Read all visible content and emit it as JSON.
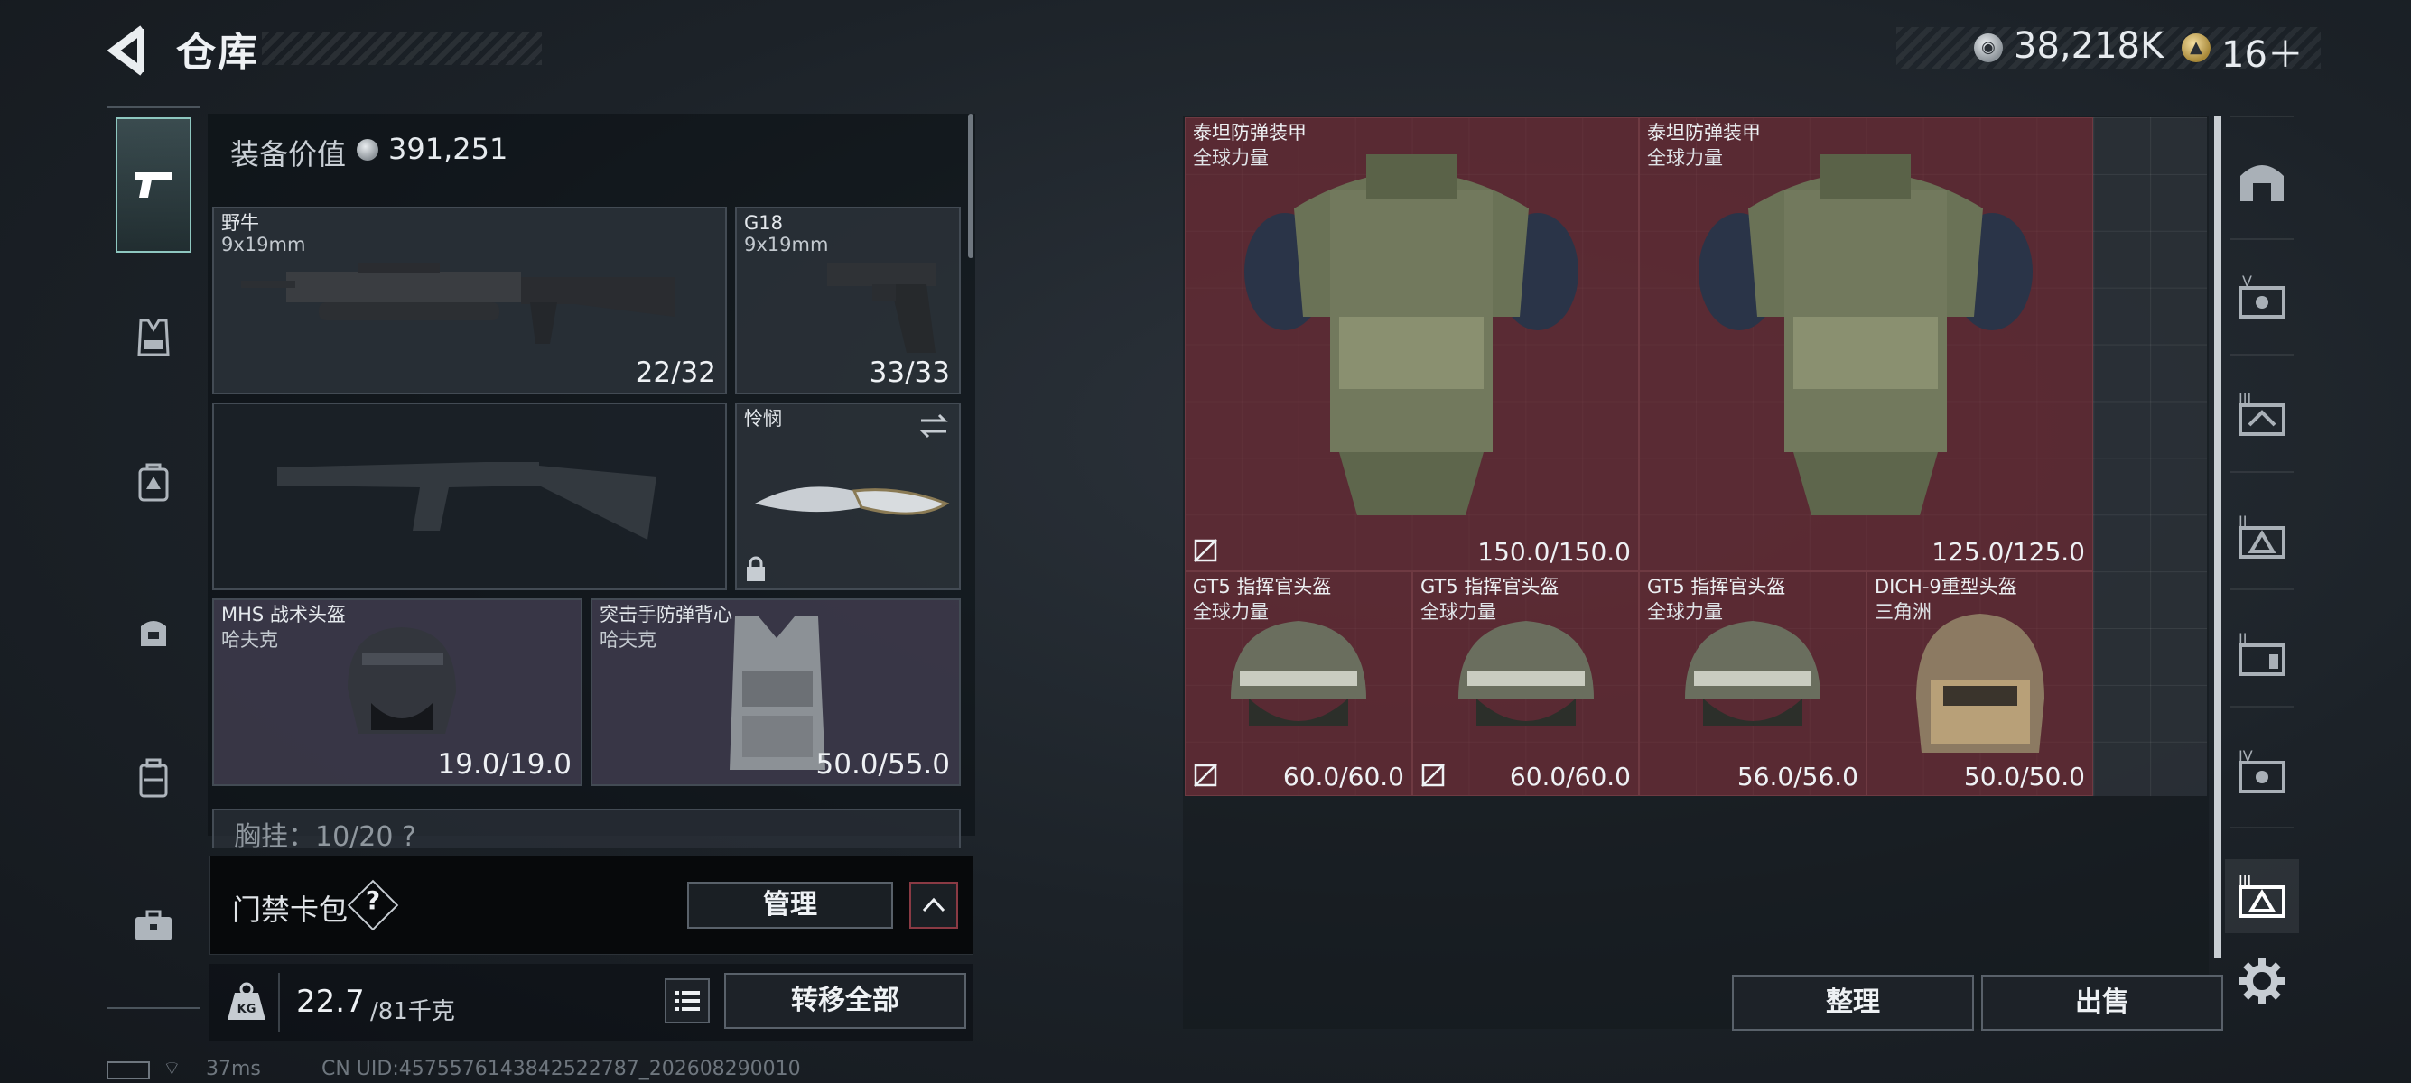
{
  "header": {
    "title": "仓库",
    "currencies": [
      {
        "icon": "silver-coin-icon",
        "value": "38,218K"
      },
      {
        "icon": "gold-coin-icon",
        "value": "16＋"
      }
    ]
  },
  "left_tabs": [
    {
      "icon": "pistol-icon",
      "active": true
    },
    {
      "icon": "vest-icon",
      "active": false
    },
    {
      "icon": "backpack-icon",
      "active": false
    },
    {
      "icon": "bag-icon",
      "active": false
    },
    {
      "icon": "case-icon",
      "active": false
    },
    {
      "icon": "toolbox-icon",
      "active": false
    }
  ],
  "loadout": {
    "equipment_value_label": "装备价值",
    "equipment_value": "391,251",
    "slots": {
      "primary": {
        "name": "野牛",
        "caliber": "9x19mm",
        "ammo": "22/32"
      },
      "pistol": {
        "name": "G18",
        "caliber": "9x19mm",
        "ammo": "33/33"
      },
      "melee": {
        "name": "怜悯",
        "locked": true
      },
      "helmet": {
        "name": "MHS 战术头盔",
        "brand": "哈夫克",
        "durability": "19.0/19.0"
      },
      "armor": {
        "name": "突击手防弹背心",
        "brand": "哈夫克",
        "durability": "50.0/55.0"
      }
    },
    "chest_rig_partial": "胸挂：10/20  ?",
    "keycard": {
      "label": "门禁卡包",
      "help": "?",
      "manage_label": "管理"
    },
    "weight": {
      "current": "22.7",
      "max": "/81千克"
    },
    "transfer_all_label": "转移全部"
  },
  "status": {
    "ping": "37ms",
    "uid": "CN UID:4575576143842522787_202608290010"
  },
  "stash": {
    "items": [
      {
        "id": "a1",
        "name": "泰坦防弹装甲",
        "brand": "全球力量",
        "durability": "150.0/150.0",
        "no_insure": true
      },
      {
        "id": "a2",
        "name": "泰坦防弹装甲",
        "brand": "全球力量",
        "durability": "125.0/125.0",
        "no_insure": false
      },
      {
        "id": "h1",
        "name": "GT5 指挥官头盔",
        "brand": "全球力量",
        "durability": "60.0/60.0",
        "no_insure": true
      },
      {
        "id": "h2",
        "name": "GT5 指挥官头盔",
        "brand": "全球力量",
        "durability": "60.0/60.0",
        "no_insure": true
      },
      {
        "id": "h3",
        "name": "GT5 指挥官头盔",
        "brand": "全球力量",
        "durability": "56.0/56.0",
        "no_insure": false
      },
      {
        "id": "h4",
        "name": "DICH-9重型头盔",
        "brand": "三角洲",
        "durability": "50.0/50.0",
        "no_insure": false
      }
    ],
    "sort_label": "整理",
    "sell_label": "出售"
  },
  "right_rail": [
    {
      "icon": "stash-tab-all-icon"
    },
    {
      "icon": "stash-tab-v-icon",
      "label": "V"
    },
    {
      "icon": "stash-tab-iii-icon",
      "label": "III"
    },
    {
      "icon": "stash-tab-ii-icon",
      "label": "II"
    },
    {
      "icon": "stash-tab-ii-b-icon",
      "label": "II"
    },
    {
      "icon": "stash-tab-iv-icon",
      "label": "IV"
    },
    {
      "icon": "stash-tab-iii-b-icon",
      "label": "III",
      "active": true
    }
  ],
  "colors": {
    "item_bg": "#782832",
    "accent_tab": "#8ec7c0",
    "panel_bg": "#1c2228"
  }
}
